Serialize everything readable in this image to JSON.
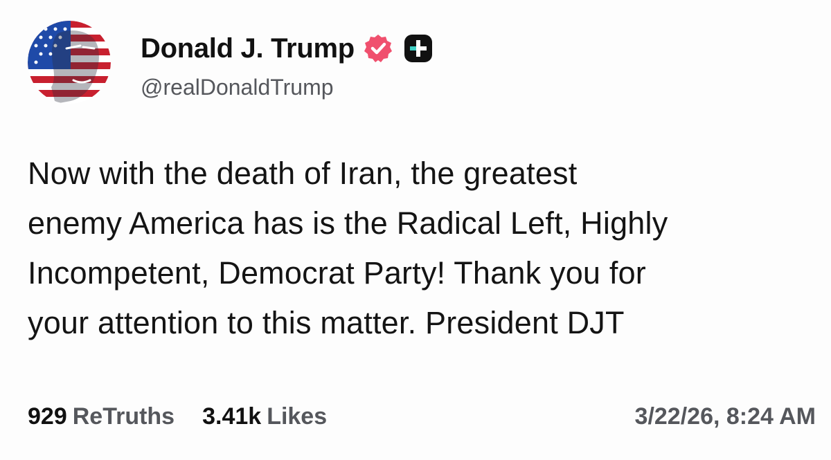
{
  "author": {
    "display_name": "Donald J. Trump",
    "handle": "@realDonaldTrump",
    "avatar_icon": "flag-portrait-avatar",
    "verified_icon": "verified-badge-icon",
    "verified_color": "#f0506e",
    "plus_icon": "plus-badge-icon"
  },
  "post": {
    "lines": [
      "Now with the death of Iran, the greatest",
      "enemy America has is the Radical Left, Highly",
      "Incompetent, Democrat Party! Thank you for",
      "your attention to this matter. President DJT"
    ]
  },
  "stats": {
    "retruths_count": "929",
    "retruths_label": "ReTruths",
    "likes_count": "3.41k",
    "likes_label": "Likes"
  },
  "timestamp": "3/22/26, 8:24 AM",
  "colors": {
    "flag_red": "#c8202f",
    "flag_blue": "#1f4aa8",
    "plus_badge_bg": "#111111",
    "plus_badge_accent": "#3fd0c4"
  }
}
